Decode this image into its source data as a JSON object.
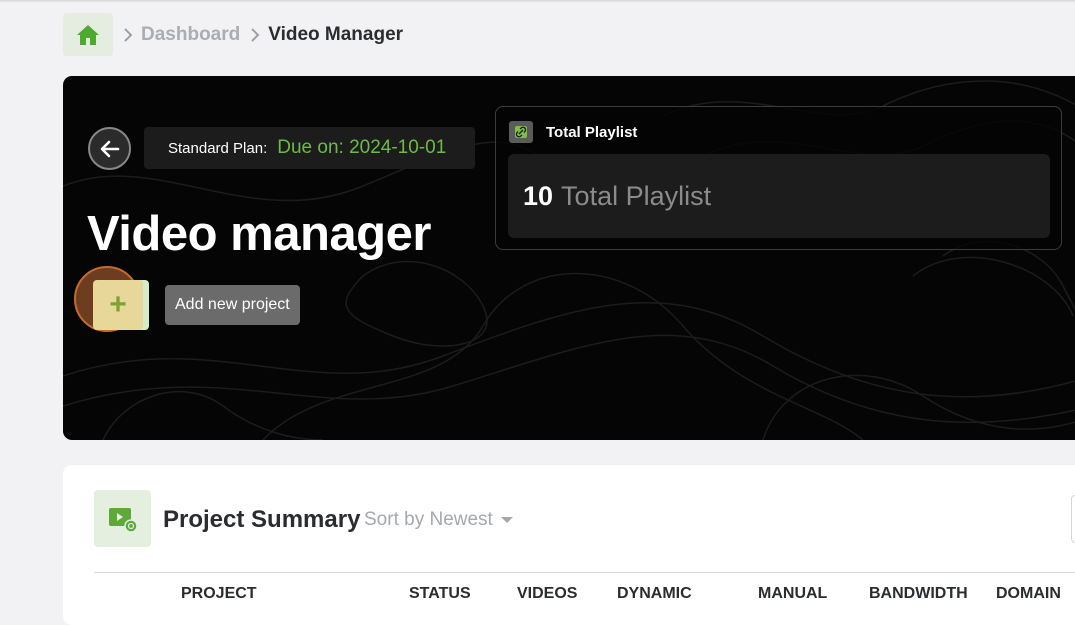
{
  "breadcrumb": {
    "home_icon": "home-icon",
    "items": [
      "Dashboard",
      "Video Manager"
    ]
  },
  "hero": {
    "plan_label": "Standard Plan:",
    "plan_due": "Due on: 2024-10-01",
    "title": "Video manager",
    "add_tooltip": "Add new project",
    "playlist": {
      "header": "Total Playlist",
      "count": "10",
      "count_label": "Total Playlist"
    }
  },
  "summary": {
    "title": "Project Summary",
    "sort_label": "Sort by Newest",
    "columns": [
      "PROJECT",
      "STATUS",
      "VIDEOS",
      "DYNAMIC",
      "MANUAL",
      "BANDWIDTH",
      "DOMAIN"
    ]
  },
  "colors": {
    "accent_green": "#6dbb45",
    "hero_bg": "#050505",
    "page_bg": "#f2f2f4"
  }
}
